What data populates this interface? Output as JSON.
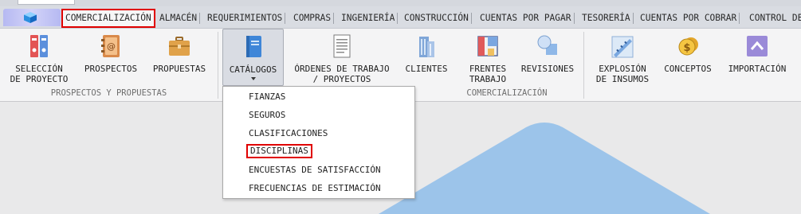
{
  "tabs": [
    {
      "label": "COMERCIALIZACIÓN",
      "active": true
    },
    {
      "label": "ALMACÉN"
    },
    {
      "label": "REQUERIMIENTOS"
    },
    {
      "label": "COMPRAS"
    },
    {
      "label": "INGENIERÍA"
    },
    {
      "label": "CONSTRUCCIÓN"
    },
    {
      "label": "CUENTAS POR PAGAR"
    },
    {
      "label": "TESORERÍA"
    },
    {
      "label": "CUENTAS POR COBRAR"
    },
    {
      "label": "CONTROL DE"
    }
  ],
  "ribbon": {
    "buttons": {
      "seleccion": "SELECCIÓN\nDE PROYECTO",
      "prospectos": "PROSPECTOS",
      "propuestas": "PROPUESTAS",
      "catalogos": "CATÁLOGOS",
      "ordenes": "ÓRDENES DE TRABAJO\n/ PROYECTOS",
      "clientes": "CLIENTES",
      "frentes": "FRENTES\nTRABAJO",
      "revisiones": "REVISIONES",
      "explosion": "EXPLOSIÓN\nDE INSUMOS",
      "conceptos": "CONCEPTOS",
      "importacion": "IMPORTACIÓN"
    },
    "groups": {
      "prospectos": "PROSPECTOS Y PROPUESTAS",
      "comercializacion": "COMERCIALIZACIÓN"
    }
  },
  "dropdown": {
    "items": [
      "FIANZAS",
      "SEGUROS",
      "CLASIFICACIONES",
      "DISCIPLINAS",
      "ENCUESTAS DE SATISFACCIÓN",
      "FRECUENCIAS DE ESTIMACIÓN"
    ],
    "highlighted": "DISCIPLINAS"
  },
  "colors": {
    "highlight_border": "#e00000",
    "workspace_shape": "#9cc4ea",
    "tab_bar": "#d9dce2",
    "ribbon": "#f4f4f5"
  }
}
